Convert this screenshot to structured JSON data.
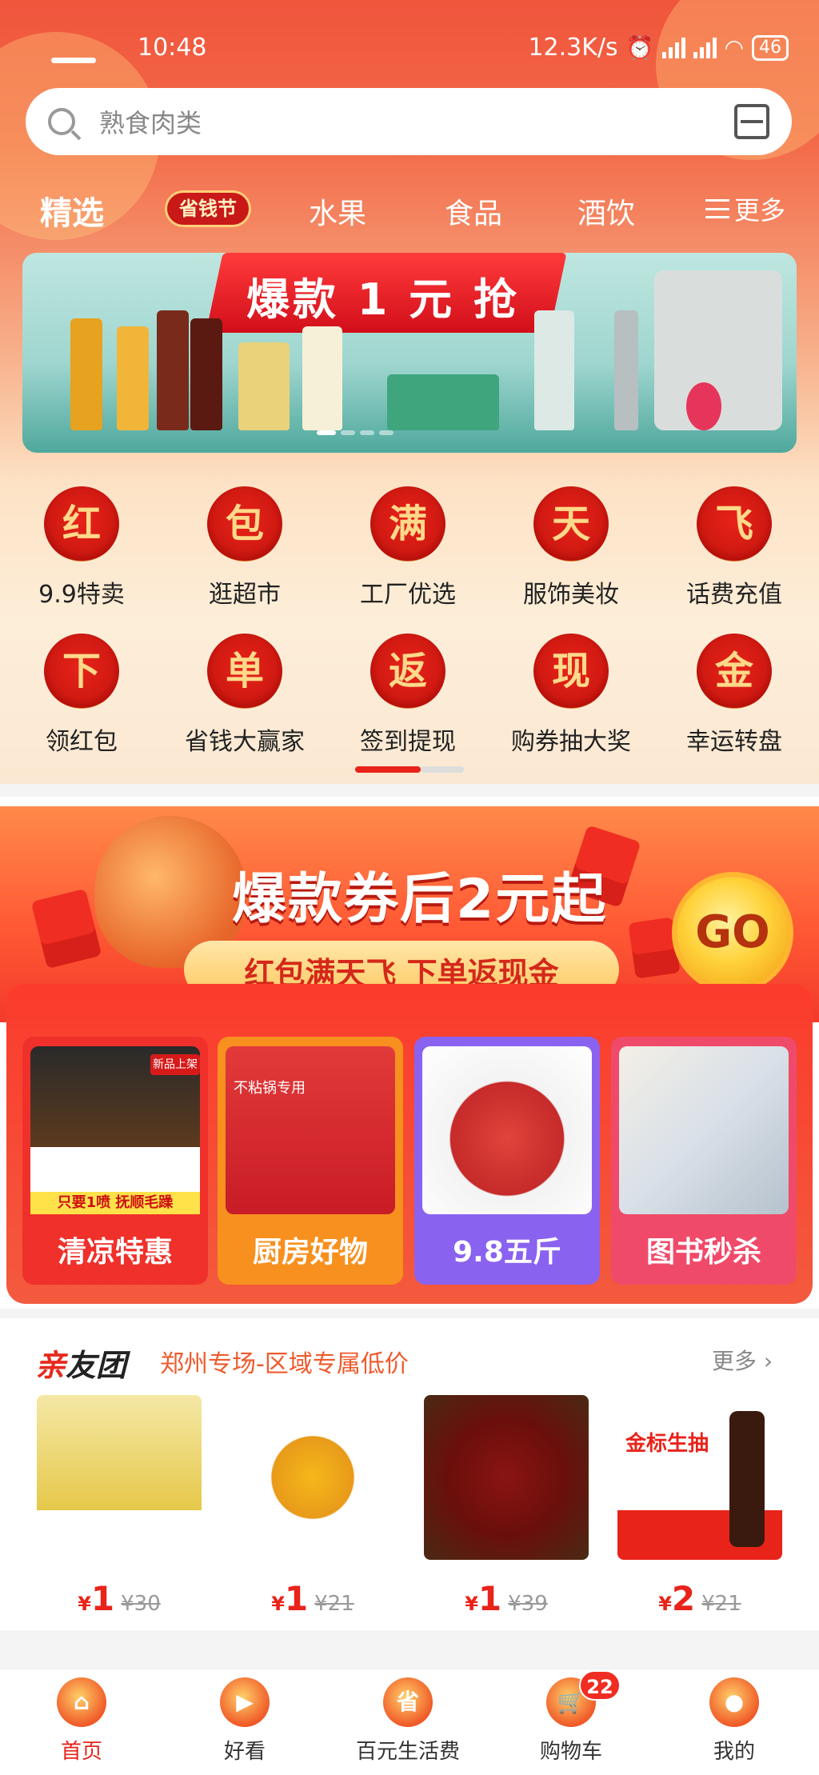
{
  "status_bar": {
    "time": "10:48",
    "network_speed": "12.3K/s",
    "battery": "46",
    "alarm_icon": "alarm-clock-icon",
    "signal_icon": "signal-icon",
    "wifi_icon": "wifi-icon"
  },
  "search": {
    "placeholder": "熟食肉类",
    "search_icon": "search-icon",
    "scan_icon": "scan-icon"
  },
  "tabs": {
    "items": [
      "精选",
      "省钱节",
      "水果",
      "食品",
      "酒饮"
    ],
    "active": "精选",
    "more": "更多"
  },
  "banner": {
    "title": "爆款 1 元 抢"
  },
  "categories": [
    {
      "glyph": "红",
      "label": "9.9特卖"
    },
    {
      "glyph": "包",
      "label": "逛超市"
    },
    {
      "glyph": "满",
      "label": "工厂优选"
    },
    {
      "glyph": "天",
      "label": "服饰美妆"
    },
    {
      "glyph": "飞",
      "label": "话费充值"
    },
    {
      "glyph": "下",
      "label": "领红包"
    },
    {
      "glyph": "单",
      "label": "省钱大赢家"
    },
    {
      "glyph": "返",
      "label": "签到提现"
    },
    {
      "glyph": "现",
      "label": "购券抽大奖"
    },
    {
      "glyph": "金",
      "label": "幸运转盘"
    }
  ],
  "promo": {
    "title": "爆款券后2元起",
    "subtitle": "红包满天飞 下单返现金",
    "go": "GO",
    "cards": [
      {
        "label": "清凉特惠",
        "badge": "新品上架",
        "caption": "只要1喷 抚顺毛躁"
      },
      {
        "label": "厨房好物",
        "caption": "不粘锅专用"
      },
      {
        "label": "9.8五斤"
      },
      {
        "label": "图书秒杀"
      }
    ]
  },
  "group": {
    "logo_a": "亲",
    "logo_b": "友团",
    "subtitle": "郑州专场-区域专属低价",
    "more": "更多 ›",
    "products": [
      {
        "price": "1",
        "original": "¥30",
        "currency": "¥"
      },
      {
        "price": "1",
        "original": "¥21",
        "currency": "¥"
      },
      {
        "price": "1",
        "original": "¥39",
        "currency": "¥"
      },
      {
        "price": "2",
        "original": "¥21",
        "currency": "¥"
      }
    ],
    "product_labels": {
      "sauce": "金标生抽"
    }
  },
  "bottom_nav": {
    "items": [
      {
        "label": "首页",
        "icon": "home-icon",
        "glyph": "⌂"
      },
      {
        "label": "好看",
        "icon": "video-icon",
        "glyph": "▶"
      },
      {
        "label": "百元生活费",
        "icon": "save-icon",
        "glyph": "省"
      },
      {
        "label": "购物车",
        "icon": "cart-icon",
        "glyph": "🛒"
      },
      {
        "label": "我的",
        "icon": "profile-icon",
        "glyph": "●"
      }
    ],
    "active": "首页",
    "cart_count": "22"
  },
  "colors": {
    "brand_red": "#e8231a",
    "header_gradient_top": "#f0553c",
    "coin_gold": "#f7d77a"
  }
}
